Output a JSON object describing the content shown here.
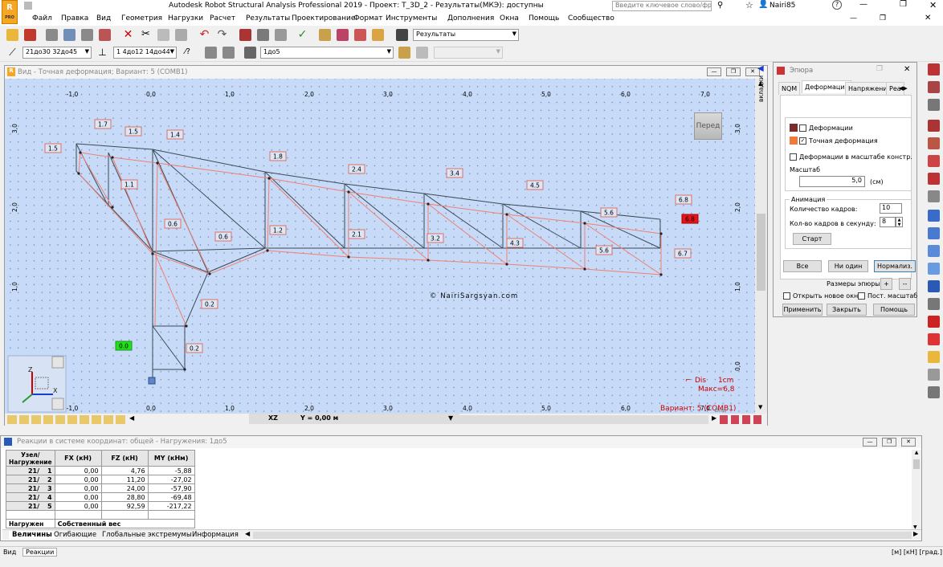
{
  "title": "Autodesk Robot Structural Analysis Professional 2019 - Проект: T_3D_2 - Результаты(МКЭ): доступны",
  "search_placeholder": "Введите ключевое слово/фразу",
  "user": "Nairi85",
  "menu": [
    "Файл",
    "Правка",
    "Вид",
    "Геометрия",
    "Нагрузки",
    "Расчет",
    "Результаты",
    "Проектирование",
    "Формат",
    "Инструменты",
    "Дополнения",
    "Окна",
    "Помощь",
    "Сообщество"
  ],
  "toolbar": {
    "layout_combo": "Результаты",
    "combo1": "21до30 32до45",
    "combo2": "1 4до12 14до44",
    "combo3": "1до5"
  },
  "view": {
    "title": "Вид - Точная деформация; Вариант: 5 (COMB1)",
    "nav_button": "Перед",
    "watermark": "© NairiSargsyan.com",
    "dis_label": "Dis",
    "dis_value": "1cm",
    "max_label": "Макс=6,8",
    "variant_label": "Вариант: 5 (COMB1)",
    "plane": "XZ",
    "y_coord": "Y = 0,00 м",
    "view_label": "Вид",
    "x_ticks": [
      "-1,0",
      "0,0",
      "1,0",
      "2,0",
      "3,0",
      "4,0",
      "5,0",
      "6,0",
      "7,0"
    ],
    "y_ticks": [
      "3,0",
      "2,0",
      "1,0",
      "0,0"
    ],
    "axis_z": "Z",
    "axis_x": "X"
  },
  "side_tab": "вкладки",
  "panel": {
    "title": "Эпюра",
    "tabs": [
      "NQM",
      "Деформация",
      "Напряжения",
      "Реа"
    ],
    "active_tab": "Деформация",
    "deformations": "Деформации",
    "exact_deformation": "Точная деформация",
    "scale_constr": "Деформации в масштабе констр.",
    "scale_label": "Масштаб",
    "scale_value": "5,0",
    "scale_unit": "(см)",
    "animation_group": "Анимация",
    "frames_label": "Количество кадров:",
    "frames_value": "10",
    "fps_label": "Кол-во кадров в секунду:",
    "fps_value": "8",
    "start": "Старт",
    "all": "Все",
    "none": "Ни один",
    "normalize": "Нормализ.",
    "sizes_label": "Размеры эпюры:",
    "plus": "+",
    "minus": "--",
    "open_new_window": "Открыть новое окно",
    "const_scale": "Пост. масштаб",
    "apply": "Применить",
    "close": "Закрыть",
    "help": "Помощь"
  },
  "table": {
    "title": "Реакции в системе координат: общей - Нагружения: 1до5",
    "headers": [
      "Узел/Нагружение",
      "FX (кН)",
      "FZ (кН)",
      "MY (кНм)"
    ],
    "rows": [
      {
        "node": "21/",
        "load": "1",
        "fx": "0,00",
        "fz": "4,76",
        "my": "-5,88"
      },
      {
        "node": "21/",
        "load": "2",
        "fx": "0,00",
        "fz": "11,20",
        "my": "-27,02"
      },
      {
        "node": "21/",
        "load": "3",
        "fx": "0,00",
        "fz": "24,00",
        "my": "-57,90"
      },
      {
        "node": "21/",
        "load": "4",
        "fx": "0,00",
        "fz": "28,80",
        "my": "-69,48"
      },
      {
        "node": "21/",
        "load": "5",
        "fx": "0,00",
        "fz": "92,59",
        "my": "-217,22"
      }
    ],
    "footer_label": "Нагружен",
    "footer_value": "Собственный вес",
    "tabs": [
      "Величины",
      "Огибающие",
      "Глобальные экстремумы",
      "Информация"
    ]
  },
  "status": {
    "left1": "Вид",
    "left2": "Реакции",
    "units": "[м] [кН] [град.]"
  },
  "labels": [
    {
      "t": "1.7"
    },
    {
      "t": "1.5"
    },
    {
      "t": "1.5"
    },
    {
      "t": "1.4"
    },
    {
      "t": "1.1"
    },
    {
      "t": "1.8"
    },
    {
      "t": "2.4"
    },
    {
      "t": "3.4"
    },
    {
      "t": "4.5"
    },
    {
      "t": "5.6"
    },
    {
      "t": "6.8"
    },
    {
      "t": "6.8",
      "red": true
    },
    {
      "t": "0.6"
    },
    {
      "t": "0.6"
    },
    {
      "t": "1.2"
    },
    {
      "t": "2.1"
    },
    {
      "t": "3.2"
    },
    {
      "t": "4.3"
    },
    {
      "t": "5.6"
    },
    {
      "t": "6.7"
    },
    {
      "t": "0.2"
    },
    {
      "t": "0.2"
    },
    {
      "t": "0.0",
      "green": true
    }
  ]
}
